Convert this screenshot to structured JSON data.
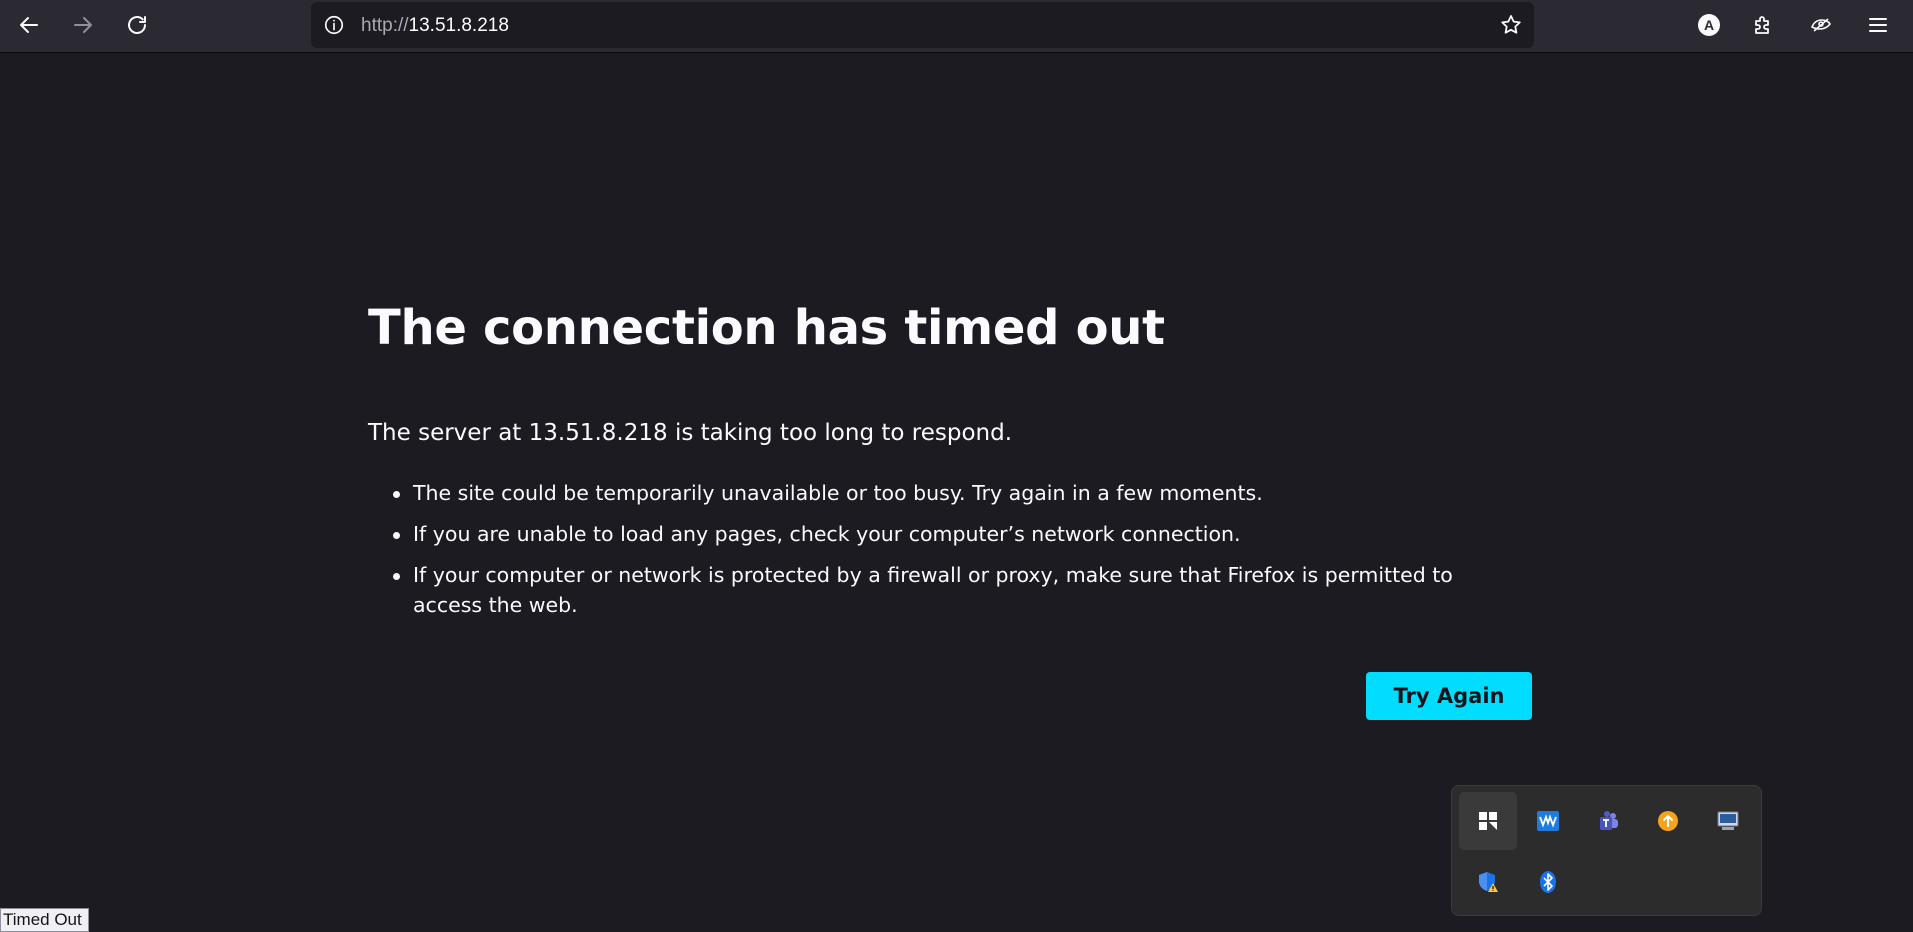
{
  "browser": {
    "url_protocol": "http://",
    "url_host": "13.51.8.218",
    "icons": {
      "back": "arrow-left-icon",
      "forward": "arrow-right-icon",
      "reload": "reload-icon",
      "site_info": "info-icon",
      "bookmark": "star-icon",
      "account": "account-icon",
      "extensions": "puzzle-icon",
      "vpn": "vpn-icon",
      "menu": "hamburger-icon"
    },
    "account_initial": "A"
  },
  "error_page": {
    "title": "The connection has timed out",
    "description": "The server at 13.51.8.218 is taking too long to respond.",
    "suggestions": [
      "The site could be temporarily unavailable or too busy. Try again in a few moments.",
      "If you are unable to load any pages, check your computer’s network connection.",
      "If your computer or network is protected by a firewall or proxy, make sure that Firefox is permitted to access the web."
    ],
    "try_again_label": "Try Again"
  },
  "tray": {
    "icons": [
      "app-tile-icon",
      "waveform-app-icon",
      "teams-icon",
      "update-arrow-icon",
      "remote-display-icon",
      "security-warning-shield-icon",
      "bluetooth-icon"
    ]
  },
  "status_text": "Timed Out",
  "colors": {
    "page_bg": "#1c1b22",
    "toolbar_bg": "#2b2a33",
    "accent": "#00ddff"
  }
}
